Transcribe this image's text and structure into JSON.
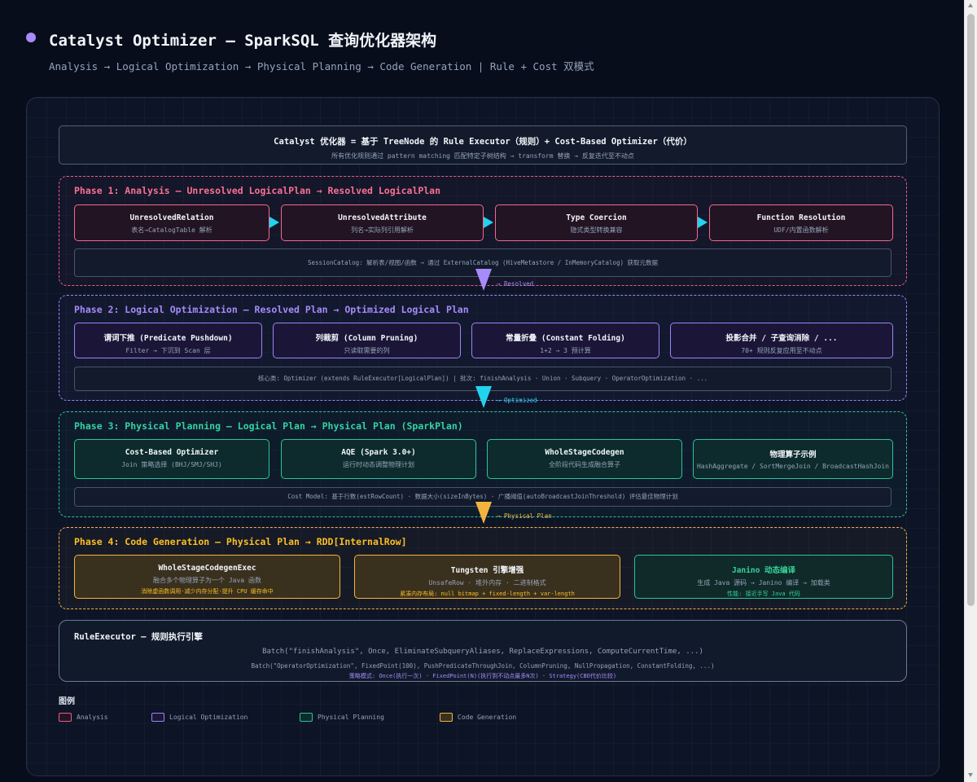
{
  "header": {
    "title": "Catalyst Optimizer — SparkSQL 查询优化器架构",
    "subtitle": "Analysis → Logical Optimization → Physical Planning → Code Generation | Rule + Cost 双模式"
  },
  "banner": {
    "title": "Catalyst 优化器 = 基于 TreeNode 的 Rule Executor（规则）+ Cost-Based Optimizer（代价）",
    "subtitle": "所有优化规则通过 pattern matching 匹配特定子树结构 → transform 替换 → 反复迭代至不动点"
  },
  "phases": [
    {
      "title": "Phase 1: Analysis — Unresolved LogicalPlan → Resolved LogicalPlan",
      "boxes": [
        {
          "title": "UnresolvedRelation",
          "desc": "表名→CatalogTable 解析"
        },
        {
          "title": "UnresolvedAttribute",
          "desc": "列名→实际列引用解析"
        },
        {
          "title": "Type Coercion",
          "desc": "隐式类型转换兼容"
        },
        {
          "title": "Function Resolution",
          "desc": "UDF/内置函数解析"
        }
      ],
      "bar": "SessionCatalog: 解析表/视图/函数 → 通过 ExternalCatalog (HiveMetastore / InMemoryCatalog) 获取元数据"
    },
    {
      "title": "Phase 2: Logical Optimization — Resolved Plan → Optimized Logical Plan",
      "boxes": [
        {
          "title": "谓词下推 (Predicate Pushdown)",
          "desc": "Filter → 下沉到 Scan 层"
        },
        {
          "title": "列裁剪 (Column Pruning)",
          "desc": "只读取需要的列"
        },
        {
          "title": "常量折叠 (Constant Folding)",
          "desc": "1+2 → 3 预计算"
        },
        {
          "title": "投影合并 / 子查询消除 / ...",
          "desc": "70+ 规则反复应用至不动点"
        }
      ],
      "bar": "核心类: Optimizer (extends RuleExecutor[LogicalPlan]) | 批次: finishAnalysis · Union · Subquery · OperatorOptimization · ..."
    },
    {
      "title": "Phase 3: Physical Planning — Logical Plan → Physical Plan (SparkPlan)",
      "boxes": [
        {
          "title": "Cost-Based Optimizer",
          "desc": "Join 策略选择 (BHJ/SMJ/SHJ)"
        },
        {
          "title": "AQE (Spark 3.0+)",
          "desc": "运行时动态调整物理计划"
        },
        {
          "title": "WholeStageCodegen",
          "desc": "全阶段代码生成融合算子"
        },
        {
          "title": "物理算子示例",
          "desc": "HashAggregate / SortMergeJoin / BroadcastHashJoin"
        }
      ],
      "bar": "Cost Model: 基于行数(estRowCount) · 数据大小(sizeInBytes) · 广播阈值(autoBroadcastJoinThreshold) 评估最佳物理计划"
    },
    {
      "title": "Phase 4: Code Generation — Physical Plan → RDD[InternalRow]",
      "boxes": [
        {
          "title": "WholeStageCodegenExec",
          "desc": "融合多个物理算子为一个 Java 函数",
          "note": "消除虚函数调用·减少内存分配·提升 CPU 缓存命中"
        },
        {
          "title": "Tungsten 引擎增强",
          "desc": "UnsafeRow · 堆外内存 · 二进制格式",
          "note": "紧凑内存布局: null bitmap + fixed-length + var-length"
        },
        {
          "title": "Janino 动态编译",
          "desc": "生成 Java 源码 → Janino 编译 → 加载类",
          "note": "性能: 接近手写 Java 代码"
        }
      ]
    }
  ],
  "connectors": [
    "→ Resolved",
    "→ Optimized",
    "→ Physical Plan"
  ],
  "rule_executor": {
    "title": "RuleExecutor — 规则执行引擎",
    "line1": "Batch(\"finishAnalysis\", Once, EliminateSubqueryAliases, ReplaceExpressions, ComputeCurrentTime, ...)",
    "line2": "Batch(\"OperatorOptimization\", FixedPoint(100), PushPredicateThroughJoin, ColumnPruning, NullPropagation, ConstantFolding, ...)",
    "line3": "策略模式: Once(执行一次) · FixedPoint(N)(执行到不动点最多N次) · Strategy(CBO代价比较)"
  },
  "legend": {
    "title": "图例",
    "items": [
      {
        "label": "Analysis",
        "color": "#ef5c83"
      },
      {
        "label": "Logical Optimization",
        "color": "#9b85f5"
      },
      {
        "label": "Physical Planning",
        "color": "#2bc59b"
      },
      {
        "label": "Code Generation",
        "color": "#f3b43f"
      }
    ]
  },
  "colors": {
    "background": "#080d1c",
    "analysis": "#ef5c83",
    "logical": "#9b85f5",
    "physical": "#2bc59b",
    "codegen": "#f3b43f",
    "arrow": "#22d3ee"
  }
}
